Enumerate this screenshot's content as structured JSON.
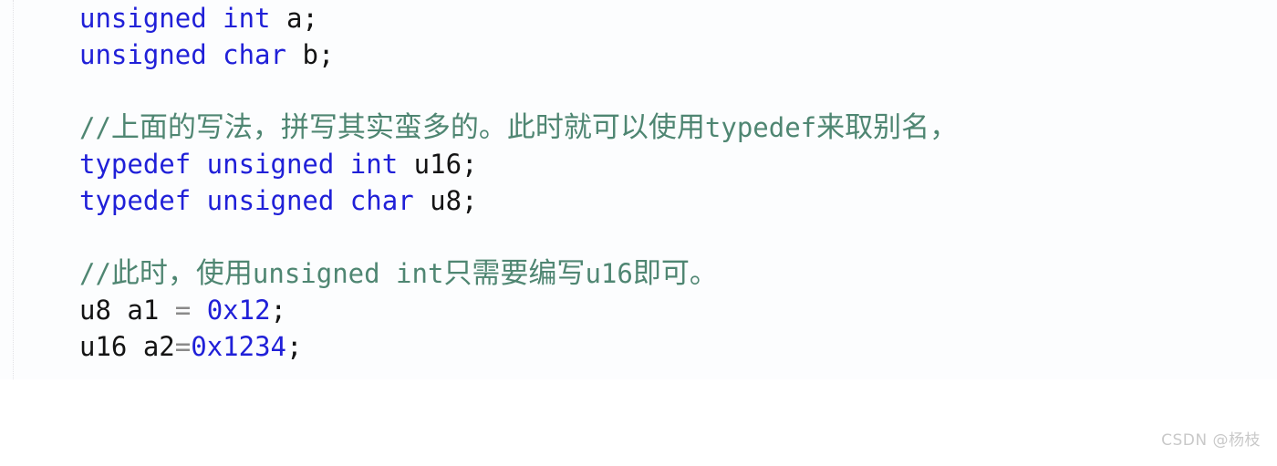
{
  "code_block": {
    "background_color": "#fcfdfe",
    "keyword_color": "#2020d8",
    "comment_color": "#4f8672",
    "plain_color": "#141414",
    "operator_color": "#8a8a8a",
    "lines": [
      {
        "id": "line-1",
        "type": "code",
        "tokens": [
          {
            "text": "unsigned int",
            "kind": "keyword"
          },
          {
            "text": " a;",
            "kind": "plain"
          }
        ]
      },
      {
        "id": "line-2",
        "type": "code",
        "tokens": [
          {
            "text": "unsigned char",
            "kind": "keyword"
          },
          {
            "text": " b;",
            "kind": "plain"
          }
        ]
      },
      {
        "id": "line-3",
        "type": "blank",
        "tokens": []
      },
      {
        "id": "line-4",
        "type": "comment",
        "text": "//上面的写法，拼写其实蛮多的。此时就可以使用typedef来取别名，",
        "tokens": [
          {
            "text": "//",
            "kind": "comment-ascii"
          },
          {
            "text": "上面的写法，拼写其实蛮多的。此时就可以使用",
            "kind": "comment-cjk"
          },
          {
            "text": "typedef",
            "kind": "comment-ascii"
          },
          {
            "text": "来取别名，",
            "kind": "comment-cjk"
          }
        ]
      },
      {
        "id": "line-5",
        "type": "code",
        "tokens": [
          {
            "text": "typedef unsigned int",
            "kind": "keyword"
          },
          {
            "text": " u16;",
            "kind": "plain"
          }
        ]
      },
      {
        "id": "line-6",
        "type": "code",
        "tokens": [
          {
            "text": "typedef unsigned char",
            "kind": "keyword"
          },
          {
            "text": " u8;",
            "kind": "plain"
          }
        ]
      },
      {
        "id": "line-7",
        "type": "blank",
        "tokens": []
      },
      {
        "id": "line-8",
        "type": "comment",
        "text": "//此时，使用unsigned int只需要编写u16即可。",
        "tokens": [
          {
            "text": "//",
            "kind": "comment-ascii"
          },
          {
            "text": "此时，使用",
            "kind": "comment-cjk"
          },
          {
            "text": "unsigned int",
            "kind": "comment-ascii"
          },
          {
            "text": "只需要编写",
            "kind": "comment-cjk"
          },
          {
            "text": "u16",
            "kind": "comment-ascii"
          },
          {
            "text": "即可。",
            "kind": "comment-cjk"
          }
        ]
      },
      {
        "id": "line-9",
        "type": "code",
        "tokens": [
          {
            "text": "u8 a1 ",
            "kind": "plain"
          },
          {
            "text": "=",
            "kind": "operator"
          },
          {
            "text": " ",
            "kind": "plain"
          },
          {
            "text": "0x12",
            "kind": "number"
          },
          {
            "text": ";",
            "kind": "punct"
          }
        ]
      },
      {
        "id": "line-10",
        "type": "code",
        "tokens": [
          {
            "text": "u16 a2",
            "kind": "plain"
          },
          {
            "text": "=",
            "kind": "operator"
          },
          {
            "text": "0x1234",
            "kind": "number"
          },
          {
            "text": ";",
            "kind": "punct"
          }
        ]
      }
    ]
  },
  "watermark": {
    "text": "CSDN @杨枝",
    "color": "#c9c9c9"
  }
}
